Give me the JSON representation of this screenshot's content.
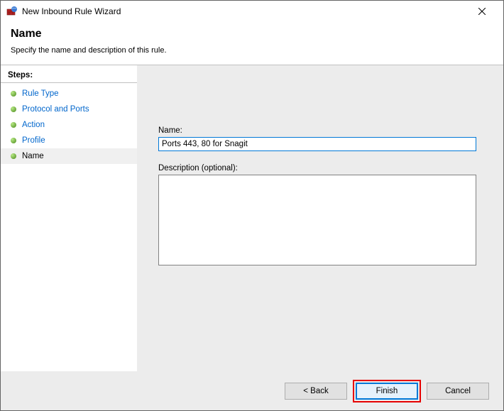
{
  "window": {
    "title": "New Inbound Rule Wizard"
  },
  "header": {
    "title": "Name",
    "subtitle": "Specify the name and description of this rule."
  },
  "sidebar": {
    "label": "Steps:",
    "items": [
      {
        "label": "Rule Type"
      },
      {
        "label": "Protocol and Ports"
      },
      {
        "label": "Action"
      },
      {
        "label": "Profile"
      },
      {
        "label": "Name"
      }
    ]
  },
  "form": {
    "name_label": "Name:",
    "name_value": "Ports 443, 80 for Snagit",
    "desc_label": "Description (optional):",
    "desc_value": ""
  },
  "buttons": {
    "back": "< Back",
    "finish": "Finish",
    "cancel": "Cancel"
  }
}
